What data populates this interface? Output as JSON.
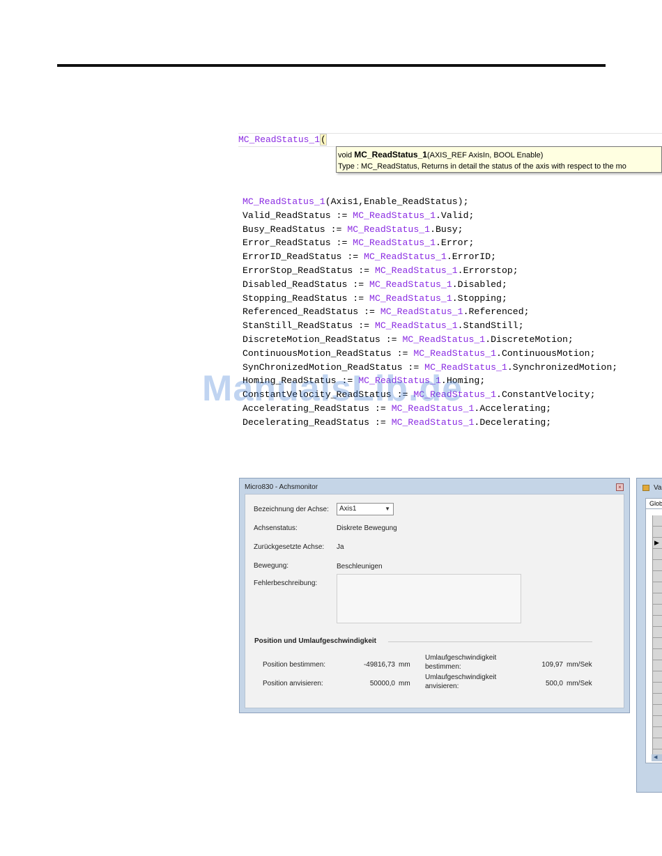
{
  "code_line": {
    "fb_name": "MC_ReadStatus_1",
    "paren": "("
  },
  "tooltip": {
    "prefix": "void ",
    "name": "MC_ReadStatus_1",
    "params": "(AXIS_REF AxisIn, BOOL Enable)",
    "type_line": "Type : MC_ReadStatus, Returns in detail the status of the axis with respect to the mo"
  },
  "code_lines": [
    {
      "pre": "",
      "fb": "MC_ReadStatus_1",
      "post": "(Axis1,Enable_ReadStatus);"
    },
    {
      "pre": "Valid_ReadStatus := ",
      "fb": "MC_ReadStatus_1",
      "post": ".Valid;"
    },
    {
      "pre": "Busy_ReadStatus := ",
      "fb": "MC_ReadStatus_1",
      "post": ".Busy;"
    },
    {
      "pre": "Error_ReadStatus := ",
      "fb": "MC_ReadStatus_1",
      "post": ".Error;"
    },
    {
      "pre": "ErrorID_ReadStatus := ",
      "fb": "MC_ReadStatus_1",
      "post": ".ErrorID;"
    },
    {
      "pre": "ErrorStop_ReadStatus := ",
      "fb": "MC_ReadStatus_1",
      "post": ".Errorstop;"
    },
    {
      "pre": "Disabled_ReadStatus := ",
      "fb": "MC_ReadStatus_1",
      "post": ".Disabled;"
    },
    {
      "pre": "Stopping_ReadStatus := ",
      "fb": "MC_ReadStatus_1",
      "post": ".Stopping;"
    },
    {
      "pre": "Referenced_ReadStatus := ",
      "fb": "MC_ReadStatus_1",
      "post": ".Referenced;"
    },
    {
      "pre": "StanStill_ReadStatus := ",
      "fb": "MC_ReadStatus_1",
      "post": ".StandStill;"
    },
    {
      "pre": "DiscreteMotion_ReadStatus := ",
      "fb": "MC_ReadStatus_1",
      "post": ".DiscreteMotion;"
    },
    {
      "pre": "ContinuousMotion_ReadStatus := ",
      "fb": "MC_ReadStatus_1",
      "post": ".ContinuousMotion;"
    },
    {
      "pre": "SynChronizedMotion_ReadStatus := ",
      "fb": "MC_ReadStatus_1",
      "post": ".SynchronizedMotion;"
    },
    {
      "pre": "Homing_ReadStatus := ",
      "fb": "MC_ReadStatus_1",
      "post": ".Homing;"
    },
    {
      "pre": "ConstantVelocity_ReadStatus := ",
      "fb": "MC_ReadStatus_1",
      "post": ".ConstantVelocity;"
    },
    {
      "pre": "Accelerating_ReadStatus := ",
      "fb": "MC_ReadStatus_1",
      "post": ".Accelerating;"
    },
    {
      "pre": "Decelerating_ReadStatus := ",
      "fb": "MC_ReadStatus_1",
      "post": ".Decelerating;"
    }
  ],
  "watermark": "ManualsLib.de",
  "achsmonitor": {
    "title": "Micro830 - Achsmonitor",
    "close_glyph": "×",
    "axis_label": "Bezeichnung der Achse:",
    "axis_value": "Axis1",
    "axis_arrow": "▼",
    "status_label": "Achsenstatus:",
    "status_value": "Diskrete Bewegung",
    "reset_label": "Zurückgesetzte Achse:",
    "reset_value": "Ja",
    "motion_label": "Bewegung:",
    "motion_value": "Beschleunigen",
    "error_label": "Fehlerbeschreibung:",
    "section_title": "Position und Umlaufgeschwindigkeit",
    "pos_actual_label": "Position bestimmen:",
    "pos_actual_value": "-49816,73",
    "pos_unit": "mm",
    "speed_actual_label_1": "Umlaufgeschwindigkeit",
    "speed_actual_label_2": "bestimmen:",
    "speed_actual_value": "109,97",
    "speed_unit": "mm/Sek",
    "pos_target_label": "Position anvisieren:",
    "pos_target_value": "50000,0",
    "speed_target_label_1": "Umlaufgeschwindigkeit",
    "speed_target_label_2": "anvisieren:",
    "speed_target_value": "500,0"
  },
  "variables_window": {
    "title": "Va",
    "tab": "Glob",
    "row_marker": "▶",
    "scroll_glyph": "◀"
  }
}
